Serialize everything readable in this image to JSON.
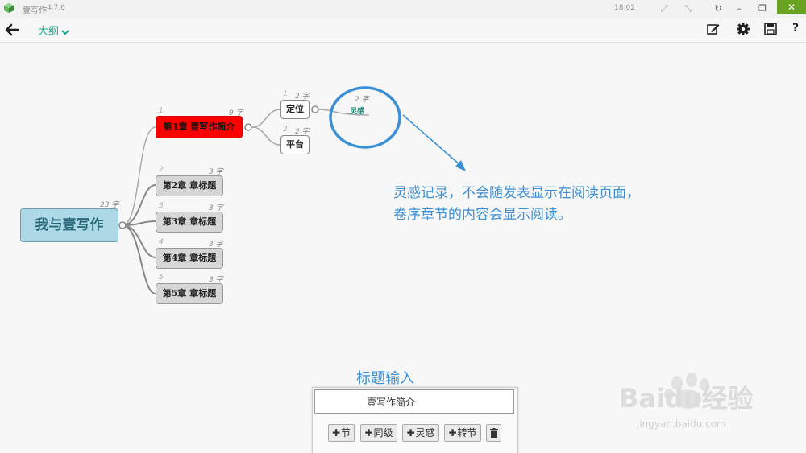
{
  "titlebar": {
    "app_name": "壹写作",
    "version": "4.7.6",
    "time": "18:02",
    "close": "✕"
  },
  "toolbar": {
    "outline_label": "大纲",
    "help_label": "?"
  },
  "mindmap": {
    "root": {
      "label": "我与壹写作",
      "count": "23 字"
    },
    "chapters": [
      {
        "num": "1",
        "label": "第1章 壹写作简介",
        "count": "9 字"
      },
      {
        "num": "2",
        "label": "第2章 章标题",
        "count": "3 字"
      },
      {
        "num": "3",
        "label": "第3章 章标题",
        "count": "3 字"
      },
      {
        "num": "4",
        "label": "第4章 章标题",
        "count": "3 字"
      },
      {
        "num": "5",
        "label": "第5章 章标题",
        "count": "3 字"
      }
    ],
    "subs": [
      {
        "num": "1",
        "label": "定位",
        "count": "2 字"
      },
      {
        "num": "2",
        "label": "平台",
        "count": "2 字"
      }
    ],
    "inspiration": {
      "label": "灵感",
      "count": "2 字"
    }
  },
  "annotation": {
    "line1": "灵感记录，不会随发表显示在阅读页面，",
    "line2": "卷序章节的内容会显示阅读。"
  },
  "title_panel": {
    "heading": "标题输入",
    "input_value": "壹写作简介",
    "buttons": [
      "节",
      "同级",
      "灵感",
      "转节"
    ]
  },
  "watermark": {
    "brand": "Baidu经验",
    "site": "jingyan.baidu.com"
  },
  "colors": {
    "accent": "#1aaa8c",
    "annotation_blue": "#3b8fd6",
    "chapter_red": "#ff0000",
    "root_blue": "#add8e6",
    "close_green": "#6aa321"
  }
}
